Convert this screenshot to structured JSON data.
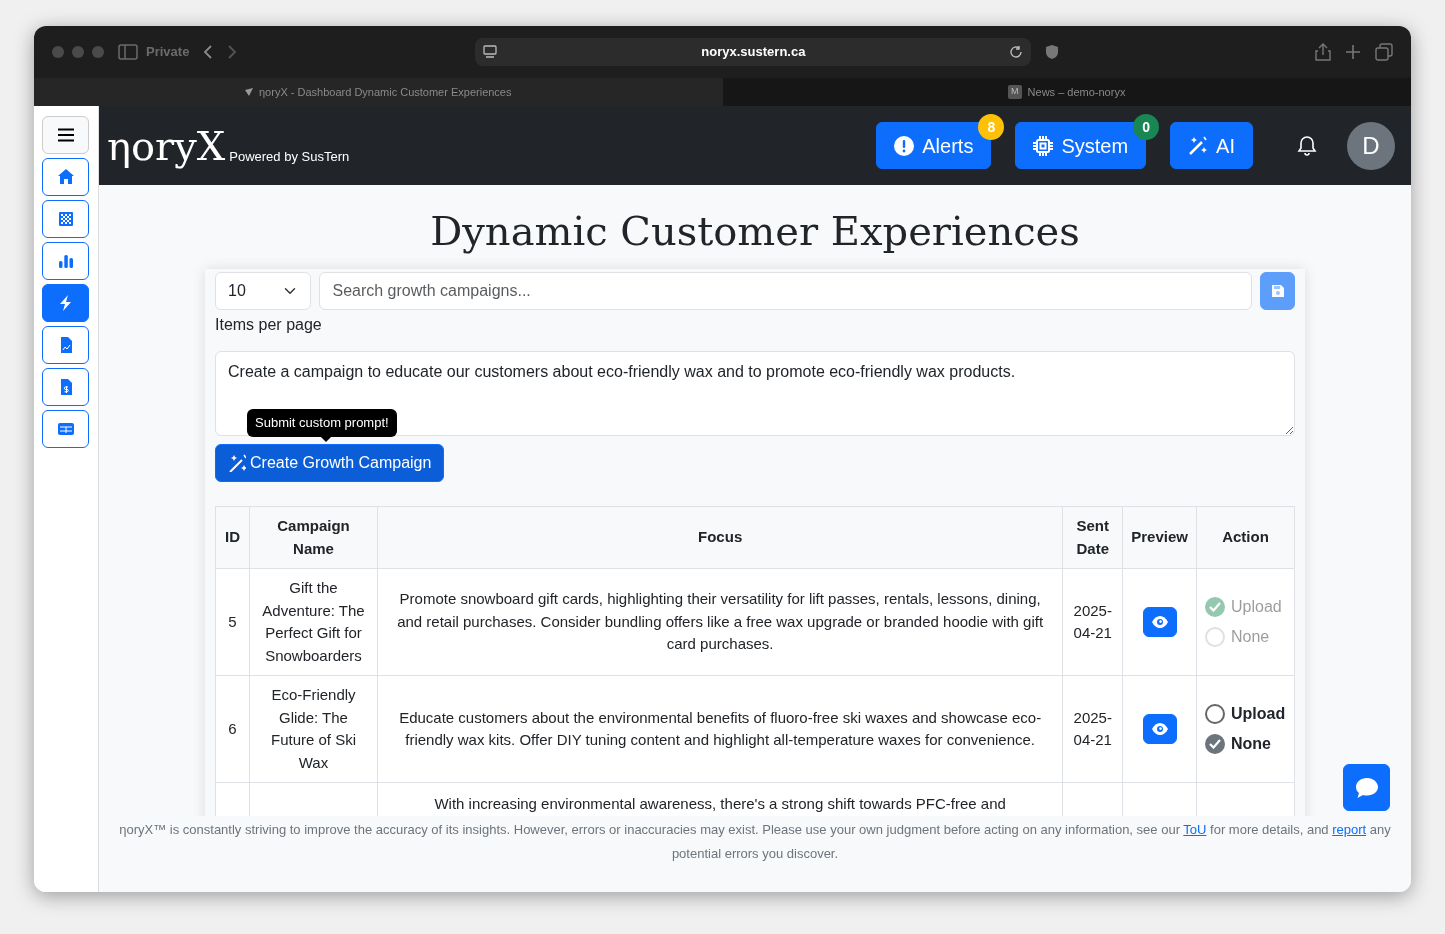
{
  "browser": {
    "private_label": "Private",
    "url": "noryx.sustern.ca",
    "tabs": [
      {
        "title": "ηoryX - Dashboard Dynamic Customer Experiences",
        "selected": true
      },
      {
        "favicon": "M",
        "title": "News – demo-noryx",
        "selected": false
      }
    ]
  },
  "sidebar": {
    "items": [
      {
        "kind": "home",
        "selected": false
      },
      {
        "kind": "grid",
        "selected": false
      },
      {
        "kind": "chart",
        "selected": false
      },
      {
        "kind": "bolt",
        "selected": true
      },
      {
        "kind": "report",
        "selected": false
      },
      {
        "kind": "invoice",
        "selected": false
      },
      {
        "kind": "table",
        "selected": false
      }
    ]
  },
  "header": {
    "logo": "ηoryX",
    "tagline": "Powered by SusTern",
    "avatar": "D",
    "buttons": [
      {
        "kind": "alerts",
        "label": "Alerts",
        "badge": "8",
        "color": "#ffc107"
      },
      {
        "kind": "system",
        "label": "System",
        "badge": "0",
        "color": "#198754"
      },
      {
        "kind": "ai",
        "label": "AI"
      }
    ]
  },
  "title": "Dynamic Customer Experiences",
  "controls": {
    "page_size": "10",
    "page_size_label": "Items per page",
    "search": {
      "placeholder": "Search growth campaigns..."
    },
    "save_disabled": true
  },
  "prompt": {
    "value": "Create a campaign to educate our customers about eco-friendly wax and to promote eco-friendly wax products.",
    "tooltip": "Submit custom prompt!",
    "button": "Create Growth Campaign"
  },
  "table": {
    "columns": [
      "ID",
      "Campaign Name",
      "Focus",
      "Sent Date",
      "Preview",
      "Action"
    ],
    "rows": [
      {
        "id": "5",
        "name": "Gift the Adventure: The Perfect Gift for Snowboarders",
        "focus": "Promote snowboard gift cards, highlighting their versatility for lift passes, rentals, lessons, dining, and retail purchases. Consider bundling offers like a free wax upgrade or branded hoodie with gift card purchases.",
        "sent_date": "2025-04-21",
        "disabled": true,
        "options": [
          {
            "kind": "upload",
            "label": "Upload",
            "selected": true
          },
          {
            "kind": "none",
            "label": "None",
            "selected": false
          }
        ]
      },
      {
        "id": "6",
        "name": "Eco-Friendly Glide: The Future of Ski Wax",
        "focus": "Educate customers about the environmental benefits of fluoro-free ski waxes and showcase eco-friendly wax kits. Offer DIY tuning content and highlight all-temperature waxes for convenience.",
        "sent_date": "2025-04-21",
        "disabled": false,
        "options": [
          {
            "kind": "upload",
            "label": "Upload",
            "selected": false
          },
          {
            "kind": "none",
            "label": "None",
            "selected": true
          }
        ]
      },
      {
        "focus": "With increasing environmental awareness, there's a strong shift towards PFC-free and"
      }
    ]
  },
  "footer": {
    "parts": [
      {
        "kind": "text",
        "text": "ηoryX™ is constantly striving to improve the accuracy of its insights. However, errors or inaccuracies may exist. Please use your own judgment before acting on any information, see our "
      },
      {
        "kind": "link",
        "text": "ToU"
      },
      {
        "kind": "text",
        "text": " for more details, and "
      },
      {
        "kind": "link",
        "text": "report"
      },
      {
        "kind": "text",
        "text": " any potential errors you discover."
      }
    ]
  }
}
